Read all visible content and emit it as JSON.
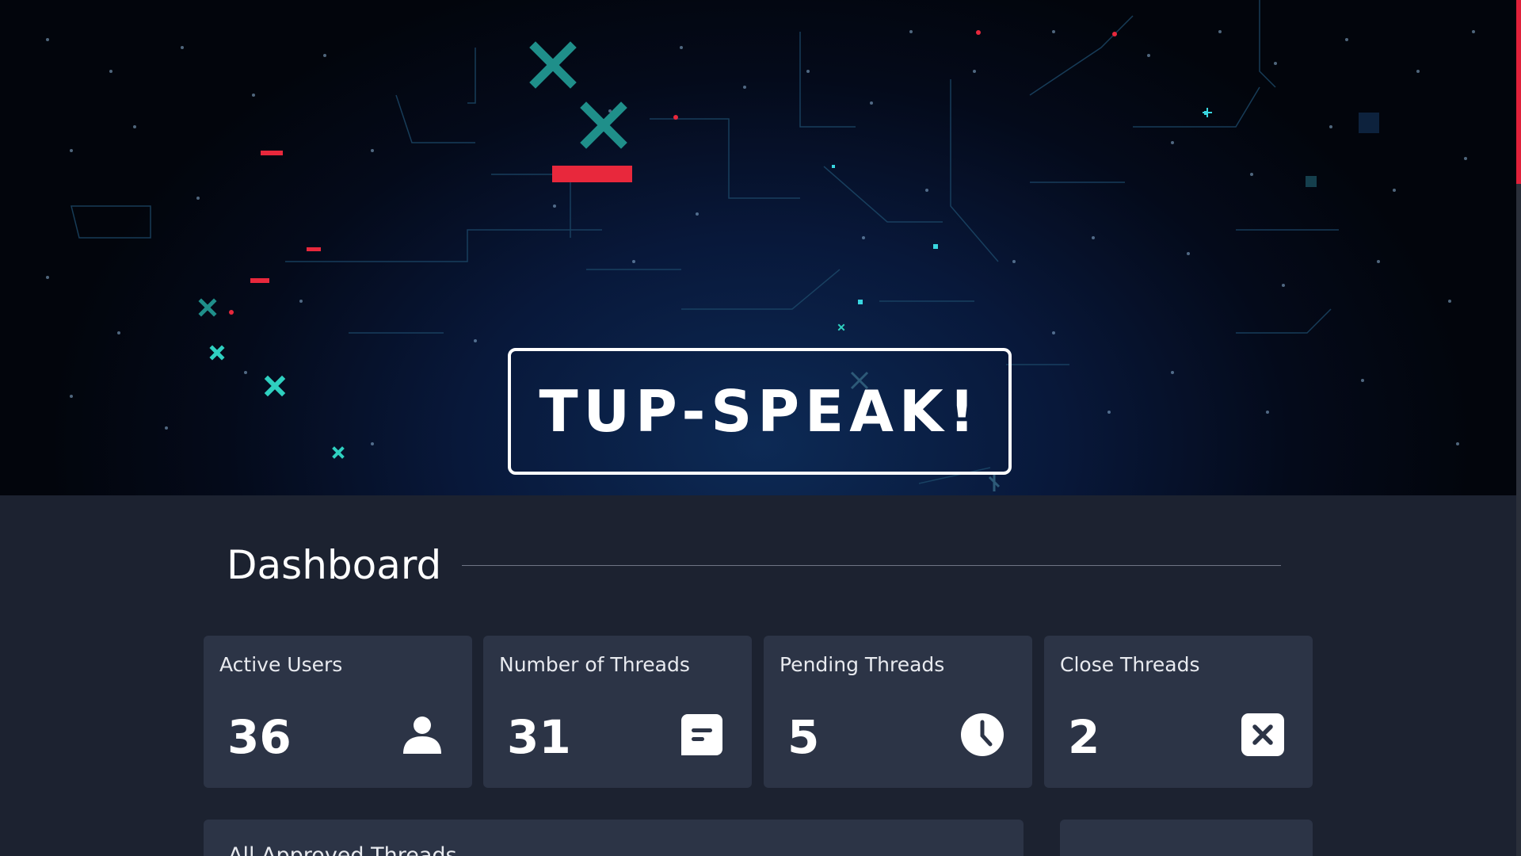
{
  "hero": {
    "brand": "TUP-SPEAK!",
    "colors": {
      "accent_red": "#e8283c",
      "accent_teal": "#1f8f8a",
      "frame": "#ffffff"
    }
  },
  "dashboard": {
    "title": "Dashboard",
    "stats": [
      {
        "label": "Active Users",
        "value": "36",
        "icon": "user-icon"
      },
      {
        "label": "Number of Threads",
        "value": "31",
        "icon": "message-icon"
      },
      {
        "label": "Pending Threads",
        "value": "5",
        "icon": "clock-icon"
      },
      {
        "label": "Close Threads",
        "value": "2",
        "icon": "close-square-icon"
      }
    ],
    "panels": {
      "approved_title": "All Approved Threads"
    }
  },
  "colors": {
    "background": "#1c2230",
    "card": "#2c3446",
    "scroll_thumb": "#e0203a"
  }
}
